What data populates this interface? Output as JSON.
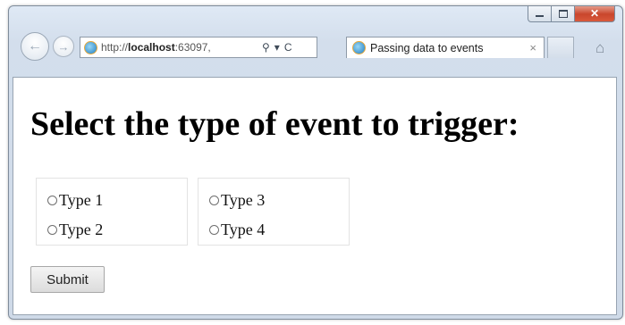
{
  "browser": {
    "address": {
      "url_prefix": "http://",
      "url_host": "localhost",
      "url_rest": ":63097,",
      "search_glyph": "⚲",
      "dropdown_glyph": "▾",
      "refresh_glyph": "C"
    },
    "tab": {
      "title": "Passing data to events",
      "close_glyph": "×"
    },
    "nav": {
      "back_glyph": "←",
      "forward_glyph": "→",
      "home_glyph": "⌂"
    },
    "window_controls": {
      "close_glyph": "✕"
    }
  },
  "page": {
    "heading": "Select the type of event to trigger:",
    "groups": [
      {
        "options": [
          "Type 1",
          "Type 2"
        ]
      },
      {
        "options": [
          "Type 3",
          "Type 4"
        ]
      }
    ],
    "submit_label": "Submit"
  },
  "colors": {
    "chrome": "#d3deec",
    "close_button": "#c9462c",
    "ie_icon": "#1f7fc3"
  },
  "icons": [
    "back-arrow-icon",
    "forward-arrow-icon",
    "ie-icon",
    "search-icon",
    "refresh-icon",
    "home-icon",
    "minimize-icon",
    "maximize-icon",
    "close-icon"
  ]
}
